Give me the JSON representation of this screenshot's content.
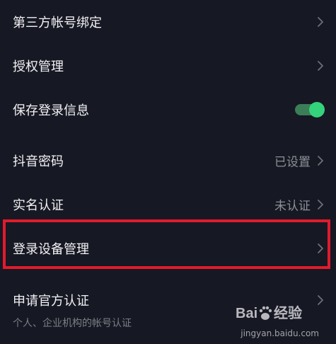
{
  "settings": {
    "items": [
      {
        "label": "第三方帐号绑定",
        "value": "",
        "trailing": "chevron"
      },
      {
        "label": "授权管理",
        "value": "",
        "trailing": "chevron"
      },
      {
        "label": "保存登录信息",
        "value": "",
        "trailing": "toggle"
      },
      {
        "label": "抖音密码",
        "value": "已设置",
        "trailing": "chevron"
      },
      {
        "label": "实名认证",
        "value": "未认证",
        "trailing": "chevron"
      },
      {
        "label": "登录设备管理",
        "value": "",
        "trailing": "chevron"
      },
      {
        "label": "申请官方认证",
        "value": "",
        "trailing": "chevron"
      }
    ],
    "save_login_toggle": {
      "on": true
    },
    "official_verification_subtext": "个人、企业机构的帐号认证"
  },
  "highlight": {
    "target": "登录设备管理",
    "color": "#e11b2c"
  },
  "watermark": {
    "brand": "Baidu",
    "brand_suffix": "经验",
    "url": "jingyan.baidu.com"
  },
  "colors": {
    "background": "#161823",
    "text_primary": "#f2f2f4",
    "text_secondary": "#8e8f96",
    "chevron": "#6e6f77",
    "toggle_track": "#3b7d57",
    "toggle_knob": "#34d27b"
  },
  "icons": {
    "row_trailing": "chevron-right-icon",
    "toggle": "toggle-switch"
  }
}
